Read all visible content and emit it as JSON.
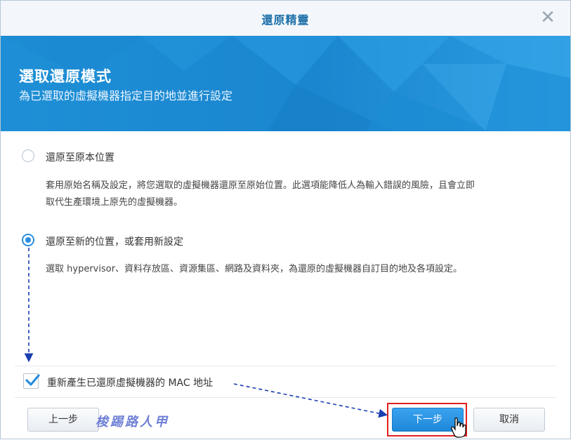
{
  "dialog": {
    "title": "還原精靈",
    "close_glyph": "✕"
  },
  "banner": {
    "title": "選取還原模式",
    "subtitle": "為已選取的虛擬機器指定目的地並進行設定"
  },
  "options": [
    {
      "label": "還原至原本位置",
      "selected": false,
      "description_lines": [
        "套用原始名稱及設定，將您選取的虛擬機器還原至原始位置。此選項能降低人為輸入錯誤的風險，且會立即",
        "取代生產環境上原先的虛擬機器。"
      ]
    },
    {
      "label": "還原至新的位置，或套用新設定",
      "selected": true,
      "description_lines": [
        "選取 hypervisor、資料存放區、資源集區、網路及資料夾，為還原的虛擬機器自訂目的地及各項設定。"
      ]
    }
  ],
  "checkbox": {
    "label": "重新產生已還原虛擬機器的 MAC 地址",
    "checked": true
  },
  "footer": {
    "back_label": "上一步",
    "next_label": "下一步",
    "cancel_label": "取消"
  },
  "watermark": "梭踢路人甲",
  "colors": {
    "accent": "#1e8fd6",
    "primary_button": "#2a8ee0",
    "highlight": "#e02020",
    "annotation_arrow": "#1a3fb0"
  }
}
